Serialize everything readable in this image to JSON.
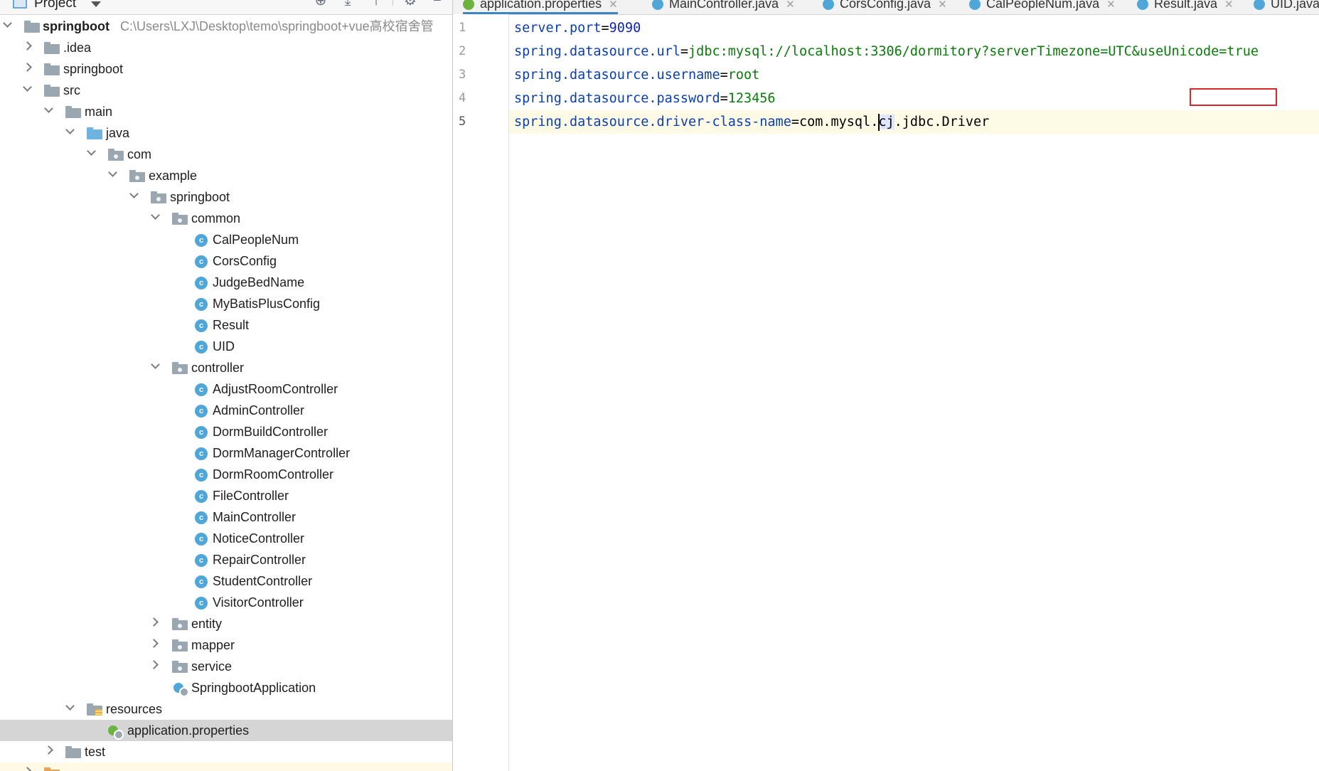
{
  "project_panel": {
    "title": "Project",
    "tree": [
      {
        "label": "springboot",
        "path": "C:\\Users\\LXJ\\Desktop\\temo\\springboot+vue高校宿舍管"
      },
      {
        "label": ".idea"
      },
      {
        "label": "springboot"
      },
      {
        "label": "src"
      },
      {
        "label": "main"
      },
      {
        "label": "java"
      },
      {
        "label": "com"
      },
      {
        "label": "example"
      },
      {
        "label": "springboot"
      },
      {
        "label": "common"
      },
      {
        "label": "CalPeopleNum"
      },
      {
        "label": "CorsConfig"
      },
      {
        "label": "JudgeBedName"
      },
      {
        "label": "MyBatisPlusConfig"
      },
      {
        "label": "Result"
      },
      {
        "label": "UID"
      },
      {
        "label": "controller"
      },
      {
        "label": "AdjustRoomController"
      },
      {
        "label": "AdminController"
      },
      {
        "label": "DormBuildController"
      },
      {
        "label": "DormManagerController"
      },
      {
        "label": "DormRoomController"
      },
      {
        "label": "FileController"
      },
      {
        "label": "MainController"
      },
      {
        "label": "NoticeController"
      },
      {
        "label": "RepairController"
      },
      {
        "label": "StudentController"
      },
      {
        "label": "VisitorController"
      },
      {
        "label": "entity"
      },
      {
        "label": "mapper"
      },
      {
        "label": "service"
      },
      {
        "label": "SpringbootApplication"
      },
      {
        "label": "resources"
      },
      {
        "label": "application.properties"
      },
      {
        "label": "test"
      }
    ]
  },
  "editor": {
    "tabs": [
      {
        "label": "application.properties"
      },
      {
        "label": "MainController.java"
      },
      {
        "label": "CorsConfig.java"
      },
      {
        "label": "CalPeopleNum.java"
      },
      {
        "label": "Result.java"
      },
      {
        "label": "UID.java"
      }
    ],
    "line_numbers": [
      "1",
      "2",
      "3",
      "4",
      "5"
    ],
    "lines": [
      {
        "key": "server.port",
        "eq": "=",
        "value": "9090"
      },
      {
        "key": "spring.datasource.url",
        "eq": "=",
        "value": "jdbc:mysql://localhost:3306/dormitory?serverTimezone=UTC&useUnicode=true"
      },
      {
        "key": "spring.datasource.username",
        "eq": "=",
        "value": "root"
      },
      {
        "key": "spring.datasource.password",
        "eq": "=",
        "value": "123456"
      },
      {
        "key": "spring.datasource.driver-class-name",
        "eq": "=",
        "value_a": "com.mysql.",
        "value_b": "cj",
        "value_c": ".jdbc.Driver"
      }
    ]
  },
  "colors": {
    "key": "#0b3fb0",
    "value": "#0b7a0b",
    "number": "#0f27b0",
    "selection": "#d5d5d5",
    "highlight_box": "#d62828",
    "class_icon": "#4fa7d9"
  }
}
